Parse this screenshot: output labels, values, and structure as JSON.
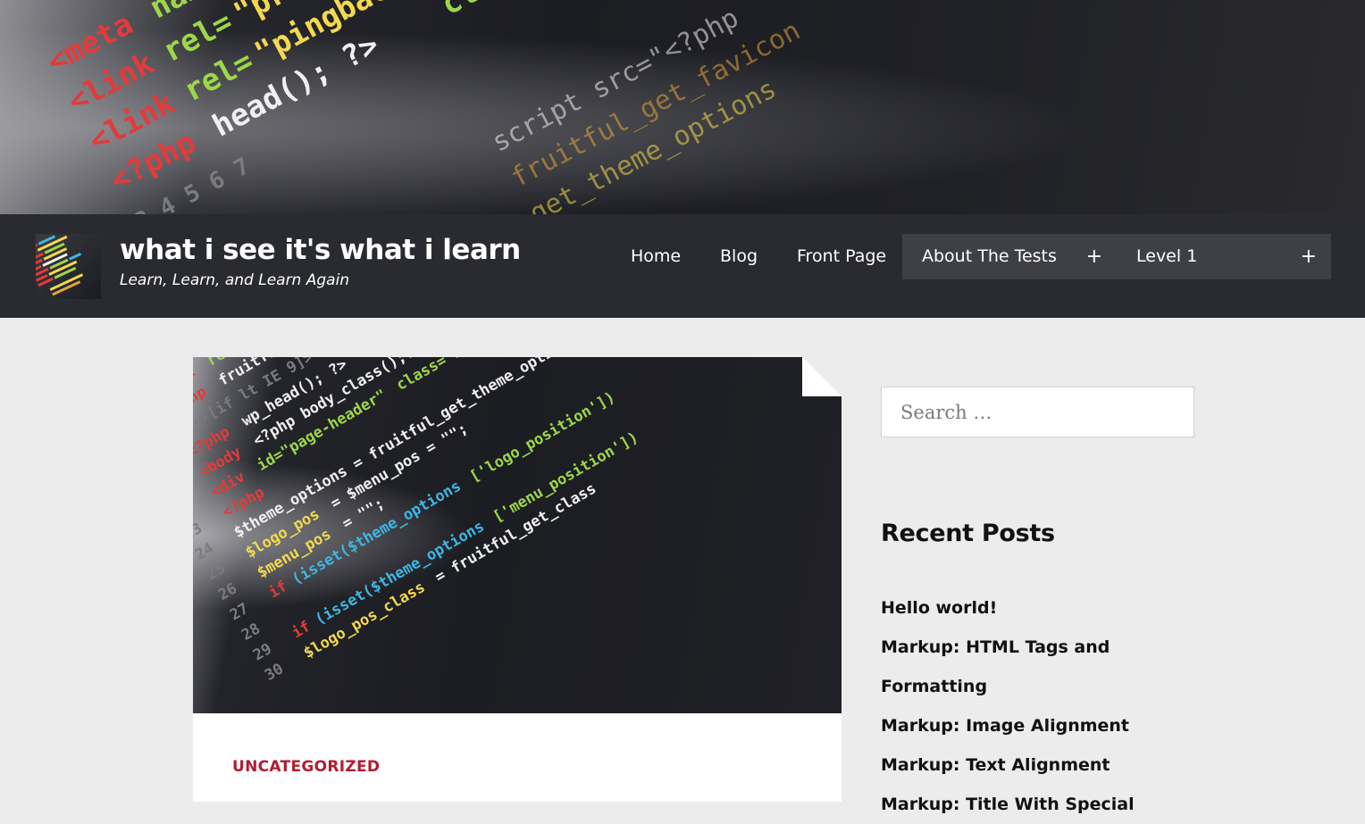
{
  "site": {
    "title": "what i see it's what i learn",
    "tagline": "Learn, Learn, and Learn Again"
  },
  "nav": {
    "items": [
      {
        "label": "Home"
      },
      {
        "label": "Blog"
      },
      {
        "label": "Front Page"
      },
      {
        "label": "About The Tests",
        "has_submenu": true,
        "toggle": "+"
      },
      {
        "label": "Level 1",
        "has_submenu": true,
        "toggle": "+"
      }
    ]
  },
  "post": {
    "category": "Uncategorized"
  },
  "sidebar": {
    "search_placeholder": "Search …",
    "recent_posts_title": "Recent Posts",
    "recent_posts": [
      "Hello world!",
      "Markup: HTML Tags and Formatting",
      "Markup: Image Alignment",
      "Markup: Text Alignment",
      "Markup: Title With Special"
    ]
  },
  "colors": {
    "navbar_bg": "#2a2b30",
    "menu_highlight": "#3f4045",
    "page_bg": "#ececec",
    "category_red": "#b01c33"
  },
  "icons": [
    "code-screen-image",
    "plus-icon"
  ]
}
